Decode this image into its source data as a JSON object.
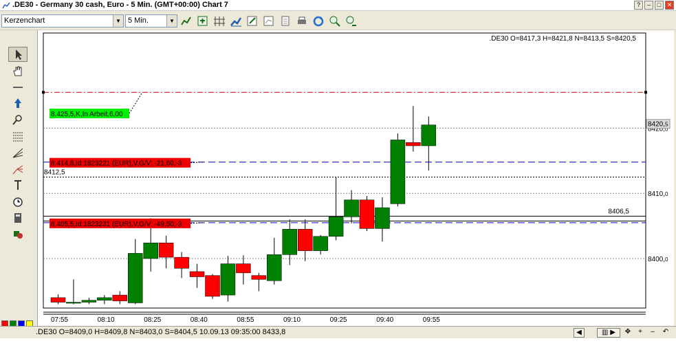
{
  "window": {
    "title": ".DE30 - Germany 30 cash, Euro - 5 Min. (GMT+00:00)   Chart 7",
    "buttons": {
      "help": "?",
      "minimize": "–",
      "maximize": "□",
      "close": "✕"
    }
  },
  "toolbar": {
    "chart_type": "Kerzenchart",
    "timeframe": "5 Min.",
    "icons": [
      "indicator-icon",
      "add-indicator-icon",
      "grid-icon",
      "trend-chart-icon",
      "edit-chart-icon",
      "compare-icon",
      "copy-icon",
      "print-icon",
      "refresh-icon",
      "link-icon",
      "unlink-icon"
    ]
  },
  "left_tools": [
    "cursor-icon",
    "hand-icon",
    "horizontal-line-icon",
    "arrow-up-icon",
    "zoom-icon",
    "fibonacci-icon",
    "fan-icon",
    "pitchfork-icon",
    "text-icon",
    "alarm-clock-icon",
    "calculator-icon",
    "shapes-icon"
  ],
  "swatches": [
    "#ff0000",
    "#008000",
    "#0000ff",
    "#ffff00",
    "#ffffff",
    "#000000",
    "#800000",
    "#808080"
  ],
  "chart": {
    "ohlc_header": ".DE30 O=8417,3 H=8421,8 N=8413,5 S=8420,5",
    "y_ticks": [
      {
        "label": "8420,",
        "dec": "0",
        "value": 8420
      },
      {
        "label": "8410,",
        "dec": "0",
        "value": 8410
      },
      {
        "label": "8400,",
        "dec": "0",
        "value": 8400
      }
    ],
    "current_price": {
      "label": "8420,",
      "dec": "5",
      "value": 8420.5
    },
    "x_ticks": [
      "07:55",
      "08:10",
      "08:25",
      "08:40",
      "08:55",
      "09:10",
      "09:25",
      "09:40",
      "09:55"
    ],
    "orders": [
      {
        "label": "8.425,5,K,In Arbeit,6,00",
        "price": 8425.5,
        "color": "#00ee00",
        "line": "#cc0000"
      },
      {
        "label": "8.414,8,Id:1823221 (EUR),V,G/V: -21,60,-3",
        "price": 8414.8,
        "color": "#ee0000",
        "line": "#0000cc"
      },
      {
        "label": "8.405,5,Id:1823231 (EUR),V,G/V: -49,50,-3",
        "price": 8405.5,
        "color": "#ee0000",
        "line": "#0000cc"
      }
    ],
    "levels": [
      {
        "label": "8412,5",
        "price": 8412.5
      },
      {
        "label": "8406,5",
        "price": 8406.5
      }
    ]
  },
  "chart_data": {
    "type": "candlestick",
    "ylim": [
      8393,
      8432
    ],
    "candles": [
      {
        "o": 8394.0,
        "h": 8394.5,
        "l": 8393.0,
        "c": 8393.3
      },
      {
        "o": 8393.3,
        "h": 8396.8,
        "l": 8393.0,
        "c": 8393.3
      },
      {
        "o": 8393.3,
        "h": 8394.0,
        "l": 8393.0,
        "c": 8393.6
      },
      {
        "o": 8393.6,
        "h": 8394.4,
        "l": 8393.0,
        "c": 8394.0
      },
      {
        "o": 8394.4,
        "h": 8395.0,
        "l": 8393.0,
        "c": 8393.5
      },
      {
        "o": 8393.2,
        "h": 8403.0,
        "l": 8393.0,
        "c": 8400.8
      },
      {
        "o": 8400.0,
        "h": 8406.2,
        "l": 8398.0,
        "c": 8402.4
      },
      {
        "o": 8402.4,
        "h": 8403.5,
        "l": 8398.5,
        "c": 8400.2
      },
      {
        "o": 8400.2,
        "h": 8401.0,
        "l": 8397.0,
        "c": 8398.5
      },
      {
        "o": 8398.0,
        "h": 8399.2,
        "l": 8395.5,
        "c": 8397.2
      },
      {
        "o": 8397.4,
        "h": 8397.6,
        "l": 8393.8,
        "c": 8394.2
      },
      {
        "o": 8394.4,
        "h": 8400.4,
        "l": 8393.4,
        "c": 8399.2
      },
      {
        "o": 8399.2,
        "h": 8400.5,
        "l": 8396.0,
        "c": 8397.8
      },
      {
        "o": 8397.4,
        "h": 8397.8,
        "l": 8395.0,
        "c": 8396.8
      },
      {
        "o": 8396.6,
        "h": 8403.2,
        "l": 8396.0,
        "c": 8400.6
      },
      {
        "o": 8400.6,
        "h": 8406.0,
        "l": 8399.0,
        "c": 8404.5
      },
      {
        "o": 8404.5,
        "h": 8406.0,
        "l": 8399.6,
        "c": 8401.2
      },
      {
        "o": 8401.2,
        "h": 8403.6,
        "l": 8400.6,
        "c": 8403.4
      },
      {
        "o": 8403.4,
        "h": 8412.5,
        "l": 8402.8,
        "c": 8406.4
      },
      {
        "o": 8406.4,
        "h": 8410.5,
        "l": 8405.4,
        "c": 8409.0
      },
      {
        "o": 8409.0,
        "h": 8409.6,
        "l": 8404.2,
        "c": 8404.6
      },
      {
        "o": 8404.6,
        "h": 8409.4,
        "l": 8402.6,
        "c": 8407.8
      },
      {
        "o": 8408.4,
        "h": 8419.2,
        "l": 8408.0,
        "c": 8418.2
      },
      {
        "o": 8417.8,
        "h": 8423.4,
        "l": 8416.4,
        "c": 8417.3
      },
      {
        "o": 8417.3,
        "h": 8421.8,
        "l": 8413.5,
        "c": 8420.5
      }
    ]
  },
  "status": {
    "text": ".DE30 O=8409,0 H=8409,8 N=8403,0 S=8404,5   10.09.13 09:35:00 8433,8",
    "nav": [
      "◀",
      "▥ ▶",
      "✥",
      "+",
      "–",
      "↶"
    ]
  }
}
